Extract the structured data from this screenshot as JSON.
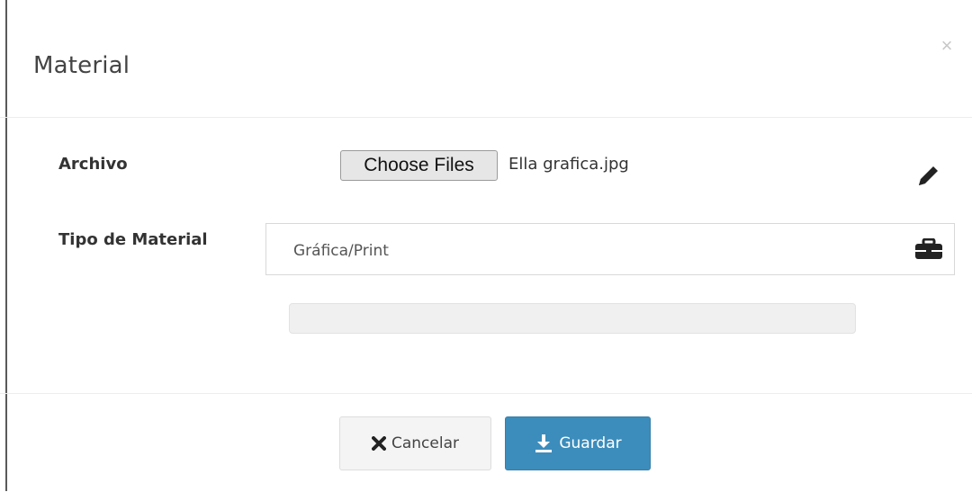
{
  "modal": {
    "title": "Material",
    "close_symbol": "×"
  },
  "form": {
    "archivo_label": "Archivo",
    "file_button_label": "Choose Files",
    "file_name": "Ella grafica.jpg",
    "tipo_label": "Tipo de Material",
    "tipo_value": "Gráfica/Print",
    "upload_progress": 0
  },
  "footer": {
    "cancel_label": "Cancelar",
    "save_label": "Guardar"
  },
  "icons": {
    "close": "close-icon",
    "edit": "pencil-icon",
    "select": "briefcase-icon",
    "cancel": "times-icon",
    "save": "download-icon"
  },
  "colors": {
    "primary": "#3c8dbc",
    "default_button": "#f4f4f4"
  }
}
